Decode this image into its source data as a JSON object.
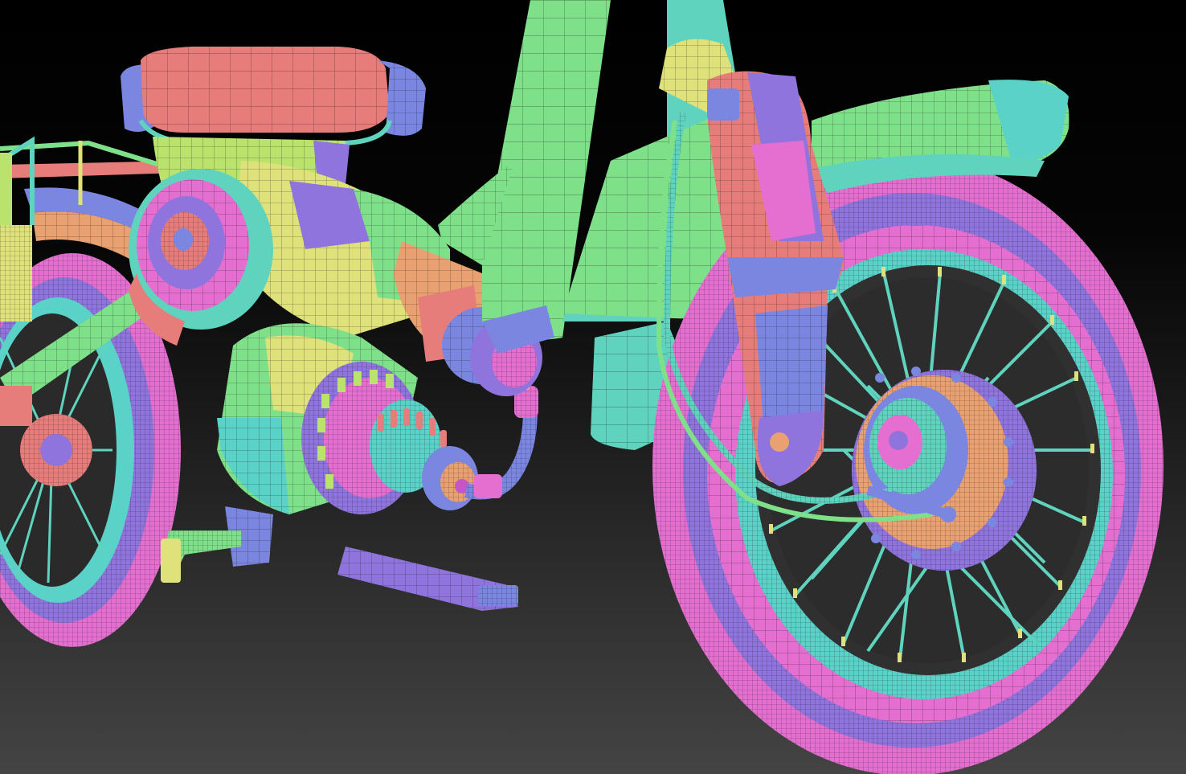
{
  "scene": {
    "subject": "scooter-polygroup-render",
    "background": {
      "top": "#000000",
      "bottom": "#444444"
    },
    "palette": {
      "green": "#7fe08a",
      "teal": "#5fd3bd",
      "cyan": "#5ad2c8",
      "pink": "#e46fd0",
      "magenta": "#c655c8",
      "salmon": "#e77d7a",
      "purple": "#8f74dd",
      "blue": "#7a86e0",
      "yellow": "#dfe27a",
      "lime": "#b9e36d",
      "orange": "#eaa172",
      "wire": "#1a1a1a"
    }
  }
}
